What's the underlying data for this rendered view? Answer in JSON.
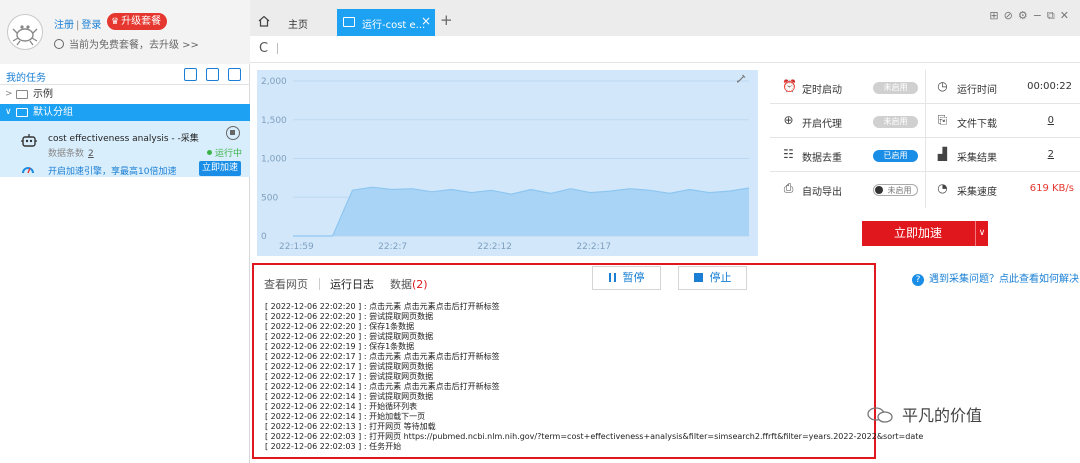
{
  "account": {
    "links": [
      "注册",
      "登录"
    ],
    "upgrade_label": "升级套餐",
    "plan_text": "当前为免费套餐，去升级 >>"
  },
  "sidebar": {
    "title": "我的任务",
    "tree": [
      {
        "label": "示例",
        "expanded": false
      },
      {
        "label": "默认分组",
        "expanded": true,
        "selected": true
      }
    ],
    "task": {
      "name": "cost effectiveness analysis - -采集",
      "records_label": "数据条数",
      "records": "2",
      "status": "运行中",
      "accel_hint": "开启加速引擎，享最高10倍加速",
      "accel_button": "立即加速"
    }
  },
  "tabs": [
    {
      "label": "主页",
      "icon": "home-icon",
      "active": false
    },
    {
      "label": "运行-cost e...",
      "icon": "document-icon",
      "active": true
    }
  ],
  "window_controls": [
    "gift-icon",
    "help-icon",
    "settings-icon",
    "minimize-icon",
    "restore-icon",
    "close-icon"
  ],
  "chart_data": {
    "type": "area",
    "x_ticks": [
      "22:1:59",
      "22:2:7",
      "22:2:12",
      "22:2:17"
    ],
    "y_ticks": [
      0,
      500,
      1000,
      1500,
      2000
    ],
    "ylim": [
      0,
      2000
    ],
    "xlim": [
      0,
      23
    ],
    "x": [
      0,
      1,
      2,
      2.5,
      3,
      4,
      5,
      6,
      7,
      8,
      9,
      10,
      11,
      12,
      13,
      14,
      15,
      16,
      17,
      18,
      19,
      20,
      21,
      22,
      23
    ],
    "y": [
      0,
      0,
      0,
      300,
      590,
      630,
      600,
      610,
      570,
      600,
      560,
      590,
      540,
      600,
      550,
      610,
      560,
      580,
      610,
      590,
      550,
      600,
      560,
      580,
      620
    ],
    "fill_color": "#a9d4f6",
    "line_color": "#8ec6f2"
  },
  "stats": {
    "left": [
      {
        "icon": "alarm-clock-icon",
        "label": "定时启动",
        "toggle": "未启用",
        "state": "off"
      },
      {
        "icon": "globe-icon",
        "label": "开启代理",
        "toggle": "未启用",
        "state": "off"
      },
      {
        "icon": "list-icon",
        "label": "数据去重",
        "toggle": "已启用",
        "state": "on"
      },
      {
        "icon": "export-icon",
        "label": "自动导出",
        "toggle": "未启用",
        "state": "switch"
      }
    ],
    "right": [
      {
        "icon": "clock-icon",
        "label": "运行时间",
        "value": "00:00:22"
      },
      {
        "icon": "file-download-icon",
        "label": "文件下载",
        "value": "0"
      },
      {
        "icon": "bar-chart-icon",
        "label": "采集结果",
        "value": "2"
      },
      {
        "icon": "speedometer-icon",
        "label": "采集速度",
        "value": "619 KB/s"
      }
    ],
    "boost_button": "立即加速"
  },
  "log_panel": {
    "tabs": [
      {
        "label": "查看网页"
      },
      {
        "label": "运行日志"
      },
      {
        "label": "数据",
        "count": "(2)"
      }
    ],
    "pause_label": "暂停",
    "stop_label": "停止",
    "help_text": "遇到采集问题？点此查看如何解决",
    "lines": [
      "[ 2022-12-06 22:02:20 ] : 点击元素 点击元素点击后打开新标签",
      "[ 2022-12-06 22:02:20 ] : 尝试提取网页数据",
      "[ 2022-12-06 22:02:20 ] : 保存1条数据",
      "[ 2022-12-06 22:02:20 ] : 尝试提取网页数据",
      "[ 2022-12-06 22:02:19 ] : 保存1条数据",
      "[ 2022-12-06 22:02:17 ] : 点击元素 点击元素点击后打开新标签",
      "[ 2022-12-06 22:02:17 ] : 尝试提取网页数据",
      "[ 2022-12-06 22:02:17 ] : 尝试提取网页数据",
      "[ 2022-12-06 22:02:14 ] : 点击元素 点击元素点击后打开新标签",
      "[ 2022-12-06 22:02:14 ] : 尝试提取网页数据",
      "[ 2022-12-06 22:02:14 ] : 开始循环列表",
      "[ 2022-12-06 22:02:14 ] : 开始加载下一页",
      "[ 2022-12-06 22:02:13 ] : 打开网页 等待加载",
      "[ 2022-12-06 22:02:03 ] : 打开网页 https://pubmed.ncbi.nlm.nih.gov/?term=cost+effectiveness+analysis&filter=simsearch2.ffrft&filter=years.2022-2022&sort=date",
      "[ 2022-12-06 22:02:03 ] : 任务开始"
    ]
  },
  "watermark": "平凡的价值"
}
